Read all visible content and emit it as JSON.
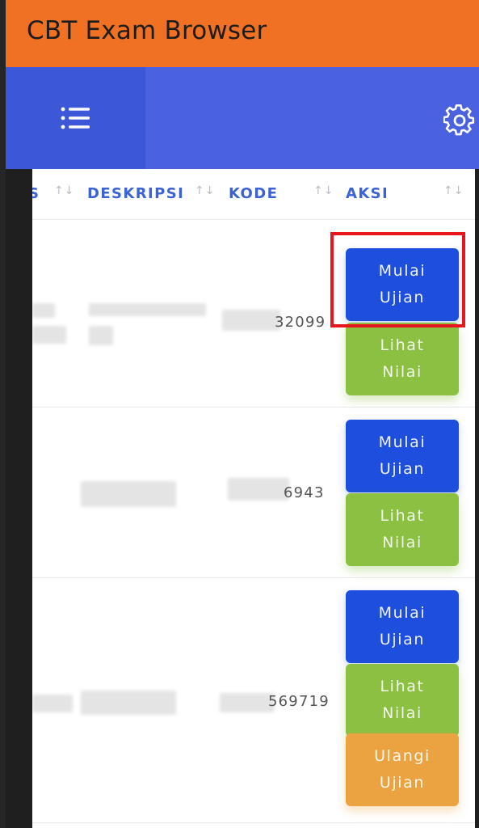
{
  "app": {
    "title": "CBT Exam Browser"
  },
  "navbar": {
    "menu_icon": "list-menu-icon",
    "settings_icon": "gear-icon"
  },
  "table": {
    "columns": [
      {
        "label": "S",
        "sort_icon": "↑↓"
      },
      {
        "label": "DESKRIPSI",
        "sort_icon": "↑↓"
      },
      {
        "label": "KODE",
        "sort_icon": "↑↓"
      },
      {
        "label": "AKSI",
        "sort_icon": "↑↓"
      }
    ],
    "rows": [
      {
        "kode": "32099",
        "actions": {
          "start": [
            "Mulai",
            "Ujian"
          ],
          "view": [
            "Lihat",
            "Nilai"
          ]
        }
      },
      {
        "kode": "6943",
        "actions": {
          "start": [
            "Mulai",
            "Ujian"
          ],
          "view": [
            "Lihat",
            "Nilai"
          ]
        }
      },
      {
        "kode": "569719",
        "actions": {
          "start": [
            "Mulai",
            "Ujian"
          ],
          "view": [
            "Lihat",
            "Nilai"
          ],
          "retake": [
            "Ulangi",
            "Ujian"
          ]
        }
      }
    ]
  },
  "colors": {
    "appbar": "#f07124",
    "navbar": "#4a62e0",
    "primary_button": "#1e4ede",
    "success_button": "#8cc043",
    "warning_button": "#eba341",
    "highlight": "#e8161c"
  }
}
